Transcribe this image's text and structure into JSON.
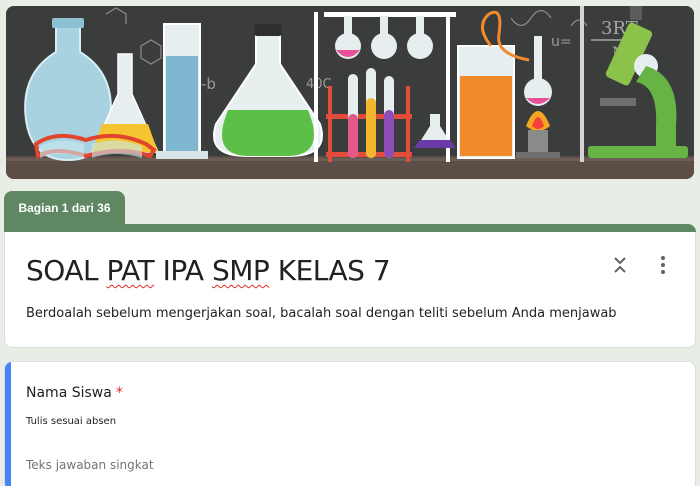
{
  "section_tab": {
    "label": "Bagian 1 dari 36"
  },
  "form": {
    "title_parts": [
      "SOAL ",
      "PAT",
      " IPA ",
      "SMP",
      " KELAS 7"
    ],
    "description": "Berdoalah sebelum mengerjakan soal, bacalah soal dengan teliti sebelum Anda menjawab"
  },
  "question": {
    "title": "Nama Siswa",
    "required_mark": "*",
    "description": "Tulis sesuai absen",
    "placeholder": "Teks jawaban singkat"
  },
  "banner": {
    "chalk_formula": "3RT",
    "chalk_formula2": "M",
    "chalk_b": "-b",
    "chalk_temp": "40C",
    "chalk_u": "u="
  },
  "icons": {
    "collapse": "collapse-icon",
    "more": "more-vert-icon"
  },
  "colors": {
    "accent": "#5f8762",
    "active": "#4285f4",
    "required": "#d93025"
  }
}
